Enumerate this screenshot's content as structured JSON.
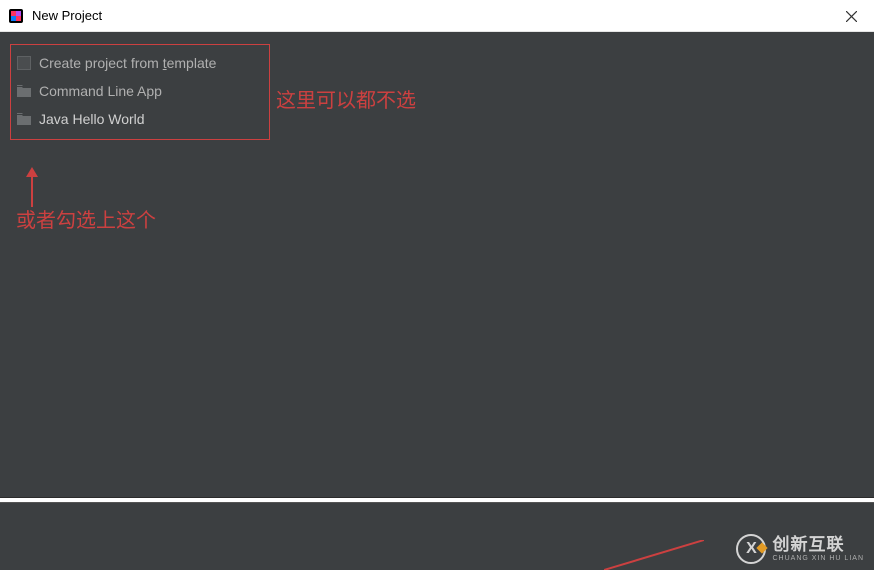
{
  "window": {
    "title": "New Project"
  },
  "templates": {
    "checkbox_label_pre": "Create project from ",
    "checkbox_label_u": "t",
    "checkbox_label_post": "emplate",
    "items": [
      {
        "label": "Command Line App"
      },
      {
        "label": "Java Hello World"
      }
    ]
  },
  "annotations": {
    "right": "这里可以都不选",
    "below": "或者勾选上这个"
  },
  "watermark": {
    "big": "创新互联",
    "small": "CHUANG XIN HU LIAN",
    "logo_letter": "X"
  },
  "colors": {
    "annotation": "#cc4040",
    "panel_bg": "#3c3f41",
    "text_muted": "#b0b0b0"
  }
}
